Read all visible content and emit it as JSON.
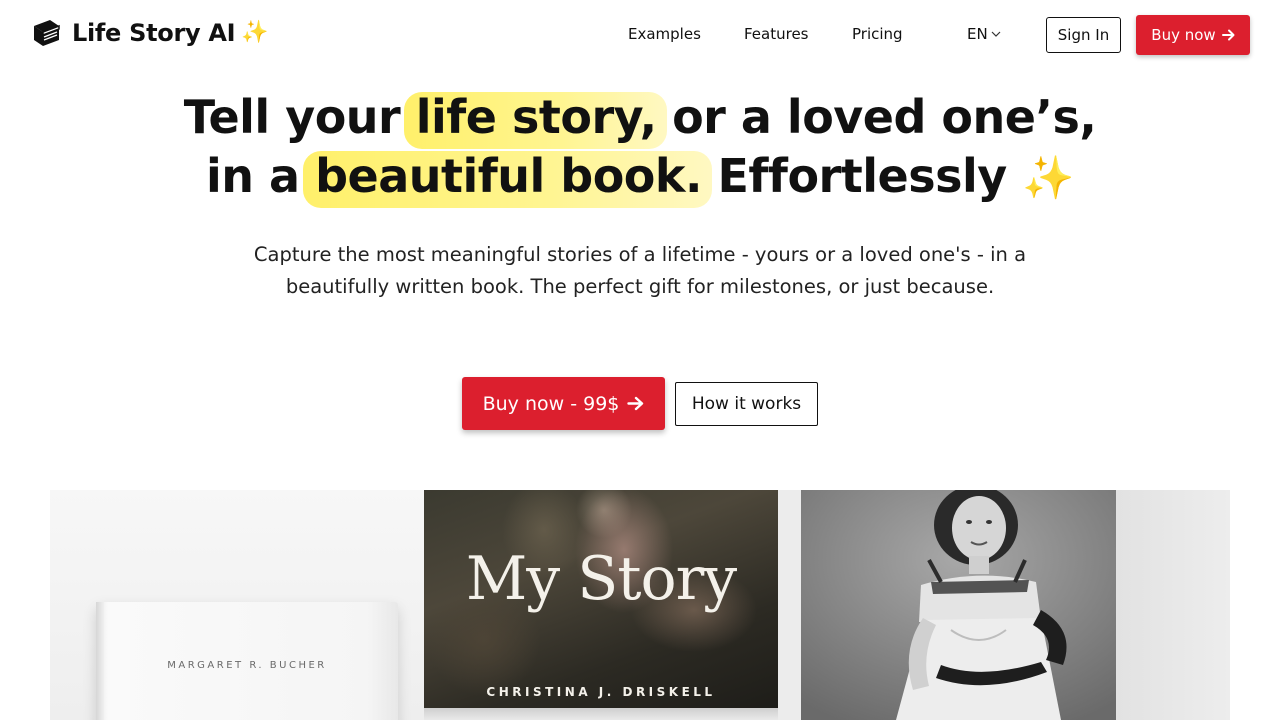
{
  "nav": {
    "brand": "Life Story AI",
    "brand_sparkle": "✨",
    "links": [
      "Examples",
      "Features",
      "Pricing"
    ],
    "language": "EN",
    "signin_label": "Sign In",
    "buy_label": "Buy now"
  },
  "hero": {
    "title_line1_pre": "Tell your ",
    "title_line1_highlight": "life story,",
    "title_line1_post": " or a loved one’s,",
    "title_line2_pre": "in a ",
    "title_line2_highlight": "beautiful book.",
    "title_line2_post": " Effortlessly ",
    "title_sparkle": "✨",
    "subtitle": "Capture the most meaningful stories of a lifetime - yours or a loved one's - in a beautifully written book. The perfect gift for milestones, or just because.",
    "buy_button": "Buy now - 99$",
    "how_button": "How it works"
  },
  "gallery": {
    "book1_author": "MARGARET R. BUCHER",
    "book2_title": "My Story",
    "book2_author": "CHRISTINA J. DRISKELL"
  },
  "colors": {
    "accent": "#dc1f2e",
    "highlight": "#fff06a"
  }
}
